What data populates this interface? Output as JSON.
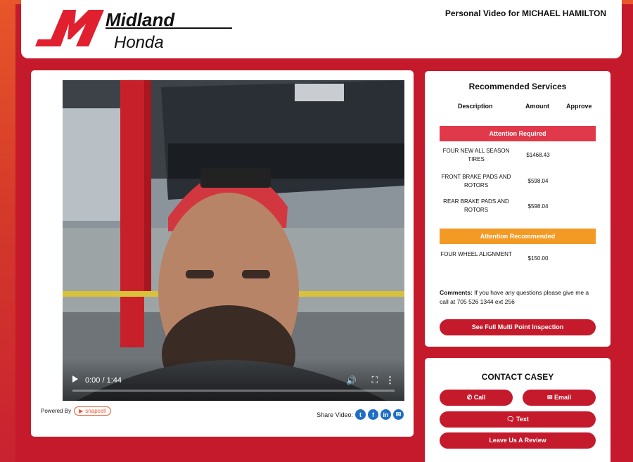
{
  "header": {
    "logo_top": "Midland",
    "logo_bottom": "Honda",
    "personal_video": "Personal Video for MICHAEL HAMILTON"
  },
  "video": {
    "time": "0:00 / 1:44",
    "progress_fraction": 0.0,
    "powered_by": "Powered By",
    "powered_brand": "snapcell",
    "share_label": "Share Video:",
    "share_icons": [
      "twitter-icon",
      "facebook-icon",
      "linkedin-icon",
      "email-icon"
    ]
  },
  "recommended": {
    "title": "Recommended Services",
    "columns": [
      "Description",
      "Amount",
      "Approve"
    ],
    "attention_required": "Attention Required",
    "required_items": [
      {
        "description": "FOUR NEW ALL SEASON TIRES",
        "amount": "$1468.43"
      },
      {
        "description": "FRONT BRAKE PADS AND ROTORS",
        "amount": "$598.04"
      },
      {
        "description": "REAR BRAKE PADS AND ROTORS",
        "amount": "$598.04"
      }
    ],
    "attention_recommended": "Attention Recommended",
    "recommended_items": [
      {
        "description": "FOUR WHEEL ALIGNMENT",
        "amount": "$150.00"
      }
    ],
    "comments_label": "Comments:",
    "comments_text": "If you have any questions please give me a call at 705 526 1344 ext 256",
    "inspection_button": "See Full Multi Point Inspection"
  },
  "contact": {
    "title": "CONTACT CASEY",
    "call": "Call",
    "email": "Email",
    "text": "Text",
    "review": "Leave Us A Review"
  },
  "colors": {
    "brand_red": "#c41a2b",
    "attention_red": "#e0394a",
    "attention_orange": "#f39a24"
  }
}
